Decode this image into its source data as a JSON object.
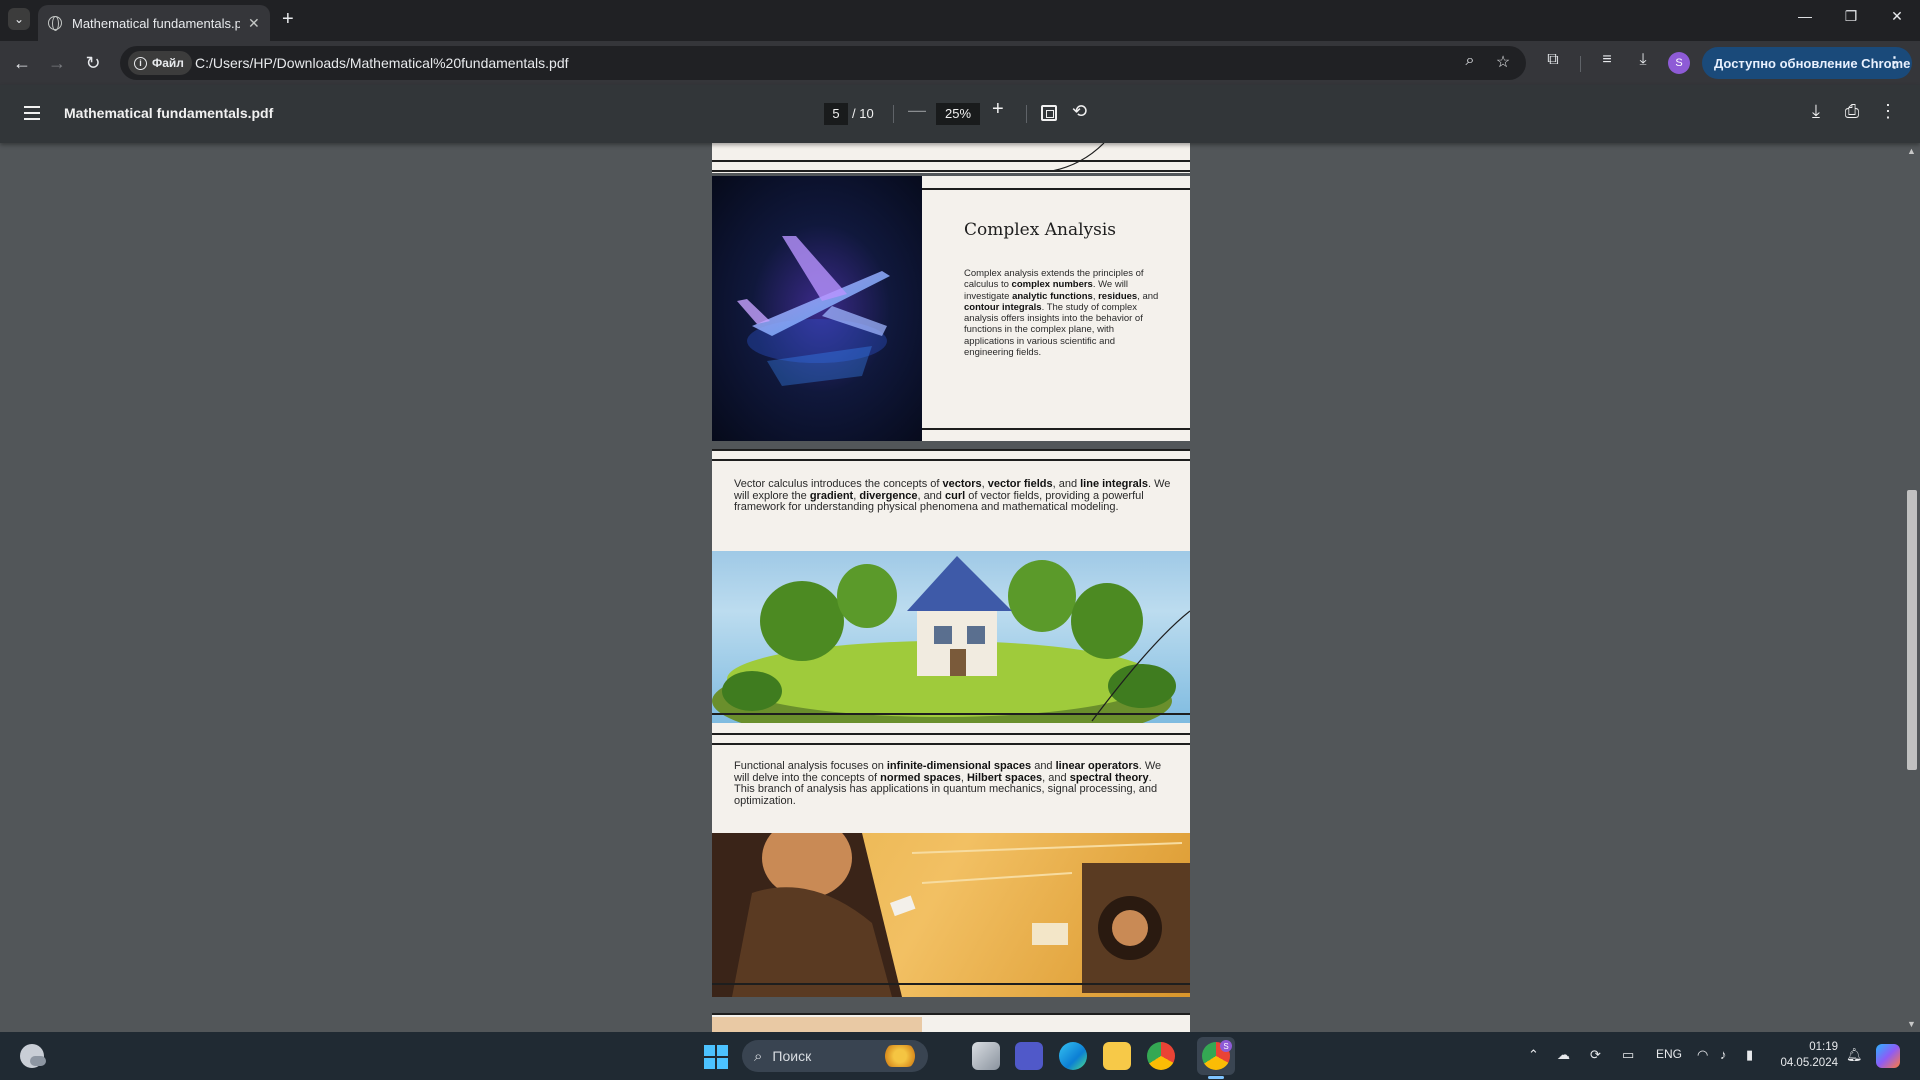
{
  "browser": {
    "tab_title": "Mathematical fundamentals.pdf",
    "new_tab": "+",
    "url_chip": "Файл",
    "url": "C:/Users/HP/Downloads/Mathematical%20fundamentals.pdf",
    "profile_initial": "S",
    "update_label": "Доступно обновление Chrome"
  },
  "pdf_toolbar": {
    "title": "Mathematical fundamentals.pdf",
    "page_current": "5",
    "page_total": "/ 10",
    "zoom": "25%"
  },
  "document": {
    "complex": {
      "heading": "Complex Analysis",
      "p1": "Complex analysis extends the principles of calculus to ",
      "b1": "complex numbers",
      "p2": ". We will investigate ",
      "b2": "analytic functions",
      "p3": ", ",
      "b3": "residues",
      "p4": ", and ",
      "b4": "contour integrals",
      "p5": ". The study of complex analysis offers insights into the behavior of functions in the complex plane, with applications in various scientific and engineering fields."
    },
    "vector": {
      "p1": "Vector calculus introduces the concepts of ",
      "b1": "vectors",
      "p2": ", ",
      "b2": "vector fields",
      "p3": ", and ",
      "b3": "line integrals",
      "p4": ". We will explore the ",
      "b4": "gradient",
      "p5": ", ",
      "b5": "divergence",
      "p6": ", and ",
      "b6": "curl",
      "p7": " of vector fields, providing a powerful framework for understanding physical phenomena and mathematical modeling."
    },
    "functional": {
      "p1": "Functional analysis focuses on ",
      "b1": "infinite-dimensional spaces",
      "p2": " and ",
      "b2": "linear operators",
      "p3": ". We will delve into the concepts of ",
      "b3": "normed spaces",
      "p4": ", ",
      "b4": "Hilbert spaces",
      "p5": ", and ",
      "b5": "spectral theory",
      "p6": ". This branch of analysis has applications in quantum mechanics, signal processing, and optimization."
    }
  },
  "taskbar": {
    "search_placeholder": "Поиск",
    "language": "ENG",
    "time": "01:19",
    "date": "04.05.2024",
    "chrome_badge": "S"
  },
  "colors": {
    "pdf_background": "#525659",
    "page_paper": "#f4f1ec",
    "accent_update": "#1a4a7a"
  }
}
